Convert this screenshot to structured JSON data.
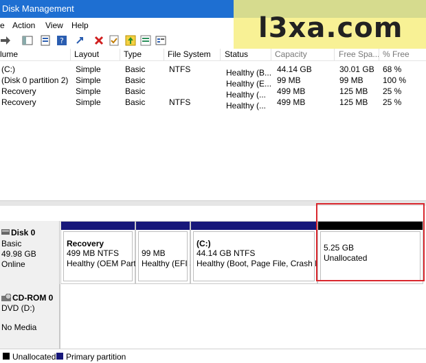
{
  "window": {
    "title": "Disk Management"
  },
  "menu": [
    {
      "label": "e"
    },
    {
      "label": "Action"
    },
    {
      "label": "View"
    },
    {
      "label": "Help"
    }
  ],
  "toolbar_icons": [
    "forward-arrow-icon",
    "console-tree-icon",
    "properties-icon",
    "help-icon",
    "refresh-icon",
    "connect-icon",
    "delete-icon",
    "checkmark-icon",
    "up-icon",
    "view-icon"
  ],
  "watermark": "l3xa.com",
  "volume_list": {
    "columns": [
      "lume",
      "Layout",
      "Type",
      "File System",
      "Status",
      "Capacity",
      "Free Spa...",
      "% Free"
    ],
    "rows": [
      [
        "(C:)",
        "Simple",
        "Basic",
        "NTFS",
        "Healthy (B...",
        "44.14 GB",
        "30.01 GB",
        "68 %"
      ],
      [
        "(Disk 0 partition 2)",
        "Simple",
        "Basic",
        "",
        "Healthy (E...",
        "99 MB",
        "99 MB",
        "100 %"
      ],
      [
        "Recovery",
        "Simple",
        "Basic",
        "",
        "Healthy (...",
        "499 MB",
        "125 MB",
        "25 %"
      ],
      [
        "Recovery",
        "Simple",
        "Basic",
        "NTFS",
        "Healthy (...",
        "499 MB",
        "125 MB",
        "25 %"
      ]
    ]
  },
  "disks": [
    {
      "name": "Disk 0",
      "type": "Basic",
      "size": "49.98 GB",
      "status": "Online",
      "partitions": [
        {
          "name": "Recovery",
          "size": "499 MB NTFS",
          "status": "Healthy (OEM Part"
        },
        {
          "name": "",
          "size": "99 MB",
          "status": "Healthy (EFI S"
        },
        {
          "name": "(C:)",
          "size": "44.14 GB NTFS",
          "status": "Healthy (Boot, Page File, Crash Dum"
        },
        {
          "name": "",
          "size": "5.25 GB",
          "status": "Unallocated"
        }
      ]
    },
    {
      "name": "CD-ROM 0",
      "type": "DVD (D:)",
      "size": "",
      "status": "No Media"
    }
  ],
  "legend": [
    {
      "label": "Unallocated",
      "color": "#000000"
    },
    {
      "label": "Primary partition",
      "color": "#17177a"
    }
  ]
}
